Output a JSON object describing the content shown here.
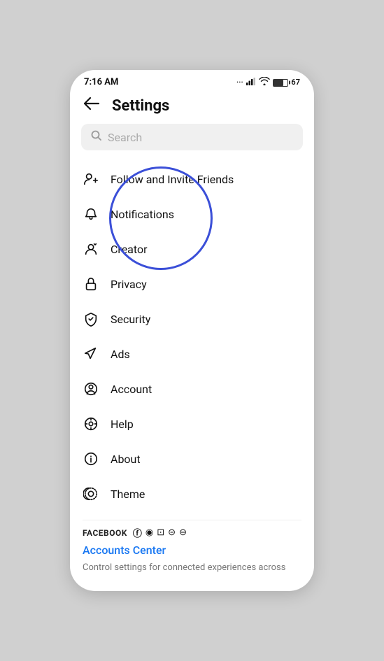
{
  "statusBar": {
    "time": "7:16 AM",
    "signal": "●●●",
    "batteryPercent": "67"
  },
  "header": {
    "backLabel": "←",
    "title": "Settings"
  },
  "search": {
    "placeholder": "Search"
  },
  "menuItems": [
    {
      "id": "follow",
      "label": "Follow and Invite Friends",
      "icon": "follow"
    },
    {
      "id": "notifications",
      "label": "Notifications",
      "icon": "bell"
    },
    {
      "id": "creator",
      "label": "Creator",
      "icon": "creator"
    },
    {
      "id": "privacy",
      "label": "Privacy",
      "icon": "lock"
    },
    {
      "id": "security",
      "label": "Security",
      "icon": "shield"
    },
    {
      "id": "ads",
      "label": "Ads",
      "icon": "ads"
    },
    {
      "id": "account",
      "label": "Account",
      "icon": "account"
    },
    {
      "id": "help",
      "label": "Help",
      "icon": "help"
    },
    {
      "id": "about",
      "label": "About",
      "icon": "about"
    },
    {
      "id": "theme",
      "label": "Theme",
      "icon": "theme"
    }
  ],
  "facebookSection": {
    "brandLabel": "FACEBOOK",
    "link": "Accounts Center",
    "sublabel": "Control settings for connected experiences across"
  }
}
